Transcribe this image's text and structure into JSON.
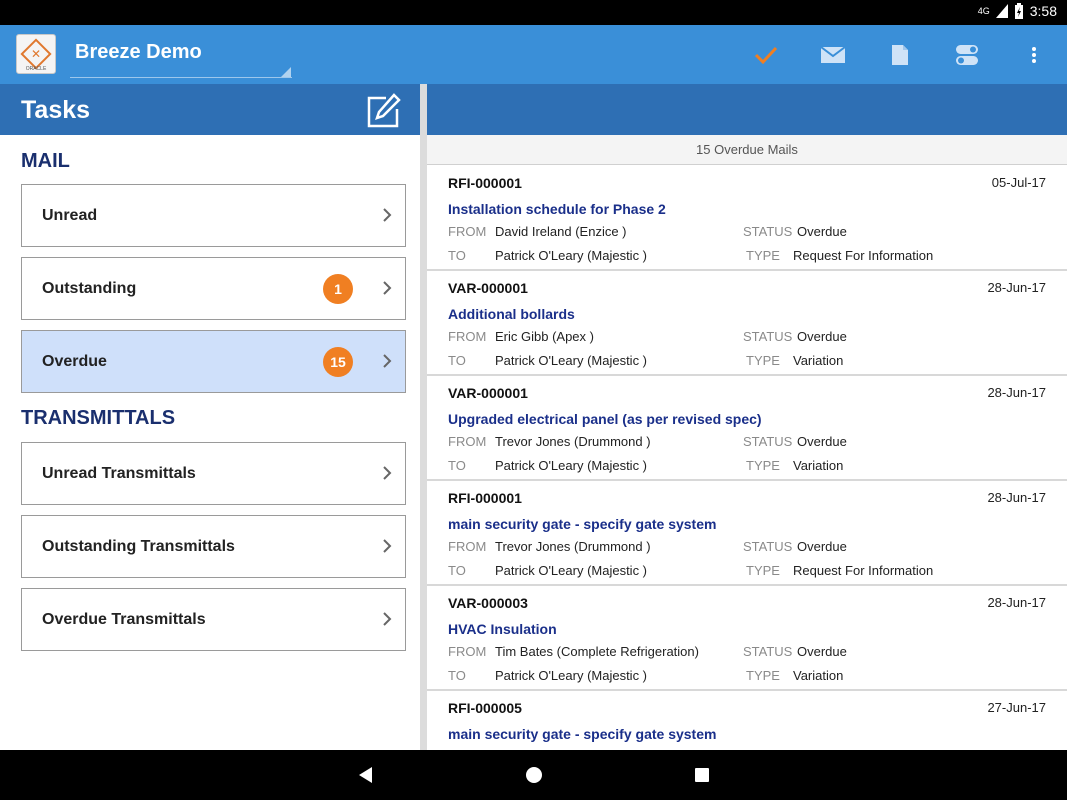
{
  "status": {
    "network": "4G",
    "time": "3:58"
  },
  "app": {
    "title": "Breeze Demo",
    "logo_sub": "ORACLE"
  },
  "toolbar_icons": [
    "check-icon",
    "mail-icon",
    "document-icon",
    "toggle-icon",
    "more-vert-icon"
  ],
  "accent_color": "#f07f22",
  "left": {
    "title": "Tasks",
    "mail_section": "MAIL",
    "mail_items": [
      {
        "label": "Unread",
        "badge": ""
      },
      {
        "label": "Outstanding",
        "badge": "1"
      },
      {
        "label": "Overdue",
        "badge": "15",
        "selected": true
      }
    ],
    "transmittals_section": "TRANSMITTALS",
    "transmittal_items": [
      {
        "label": "Unread Transmittals"
      },
      {
        "label": "Outstanding Transmittals"
      },
      {
        "label": "Overdue Transmittals"
      }
    ]
  },
  "right": {
    "summary": "15 Overdue Mails",
    "labels": {
      "from": "FROM",
      "to": "TO",
      "status": "STATUS",
      "type": "TYPE"
    },
    "mails": [
      {
        "code": "RFI-000001",
        "date": "05-Jul-17",
        "subject": "Installation schedule for Phase 2",
        "from": "David Ireland (Enzice  )",
        "to": "Patrick O'Leary (Majestic )",
        "status": "Overdue",
        "type": "Request For Information"
      },
      {
        "code": "VAR-000001",
        "date": "28-Jun-17",
        "subject": "Additional bollards",
        "from": "Eric Gibb (Apex )",
        "to": "Patrick O'Leary (Majestic )",
        "status": "Overdue",
        "type": "Variation"
      },
      {
        "code": "VAR-000001",
        "date": "28-Jun-17",
        "subject": "Upgraded electrical panel (as per revised spec)",
        "from": "Trevor Jones (Drummond )",
        "to": "Patrick O'Leary (Majestic )",
        "status": "Overdue",
        "type": "Variation"
      },
      {
        "code": "RFI-000001",
        "date": "28-Jun-17",
        "subject": "main security gate - specify gate system",
        "from": "Trevor Jones (Drummond )",
        "to": "Patrick O'Leary (Majestic )",
        "status": "Overdue",
        "type": "Request For Information"
      },
      {
        "code": "VAR-000003",
        "date": "28-Jun-17",
        "subject": "HVAC Insulation",
        "from": "Tim Bates (Complete Refrigeration)",
        "to": "Patrick O'Leary (Majestic )",
        "status": "Overdue",
        "type": "Variation"
      },
      {
        "code": "RFI-000005",
        "date": "27-Jun-17",
        "subject": "main security gate - specify gate system",
        "from": "",
        "to": "",
        "status": "",
        "type": ""
      }
    ]
  }
}
